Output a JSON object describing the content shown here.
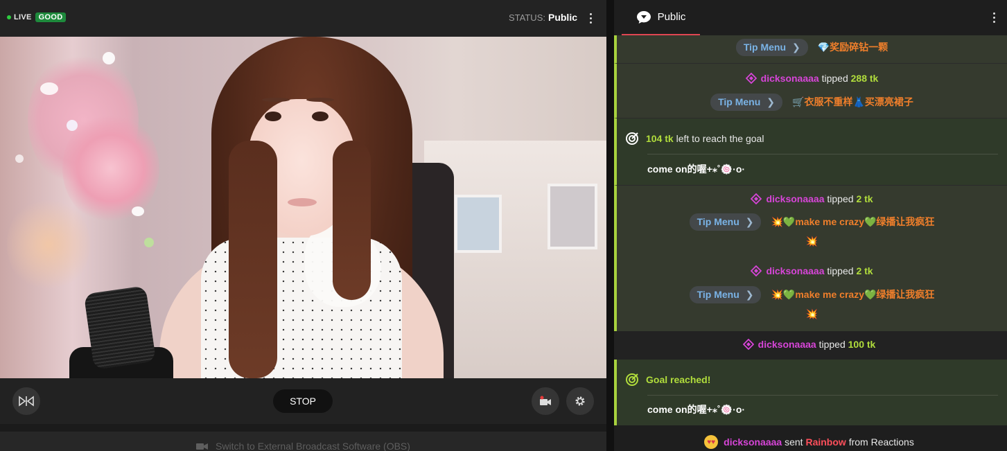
{
  "broadcast": {
    "live_label": "LIVE",
    "connection_label": "GOOD",
    "status_label": "STATUS:",
    "status_value": "Public",
    "stop_label": "STOP",
    "obs_label": "Switch to External Broadcast Software (OBS)"
  },
  "chat": {
    "tab_label": "Public",
    "tipmenu_label": "Tip Menu",
    "messages": [
      {
        "type": "tipmenu",
        "text": "💎奖励碎钻一颗"
      },
      {
        "type": "tip",
        "user": "dicksonaaaa",
        "verb": "tipped",
        "amount": "288 tk",
        "menu_text": "🛒衣服不重样👗买漂亮裙子"
      },
      {
        "type": "goal",
        "amount": "104 tk",
        "text": "left to reach the goal",
        "subtitle": "come on的喔+⁎˚🍥·o·"
      },
      {
        "type": "tip",
        "user": "dicksonaaaa",
        "verb": "tipped",
        "amount": "2 tk",
        "menu_prefix": "💥💚",
        "menu_text": "make me crazy",
        "menu_suffix": "💚绿播让我疯狂",
        "extra": "💥"
      },
      {
        "type": "tip",
        "user": "dicksonaaaa",
        "verb": "tipped",
        "amount": "2 tk",
        "menu_prefix": "💥💚",
        "menu_text": "make me crazy",
        "menu_suffix": "💚绿播让我疯狂",
        "extra": "💥"
      },
      {
        "type": "tip",
        "user": "dicksonaaaa",
        "verb": "tipped",
        "amount": "100 tk"
      },
      {
        "type": "goal_reached",
        "text": "Goal reached!",
        "subtitle": "come on的喔+⁎˚🍥·o·"
      },
      {
        "type": "reaction",
        "user": "dicksonaaaa",
        "verb": "sent",
        "item": "Rainbow",
        "suffix": "from Reactions"
      }
    ]
  },
  "colors": {
    "accent_green": "#a8d23e",
    "tab_underline": "#e04652",
    "username": "#d745d8",
    "token": "#b1dd3c",
    "tipmenu_text": "#7ab3e6"
  }
}
